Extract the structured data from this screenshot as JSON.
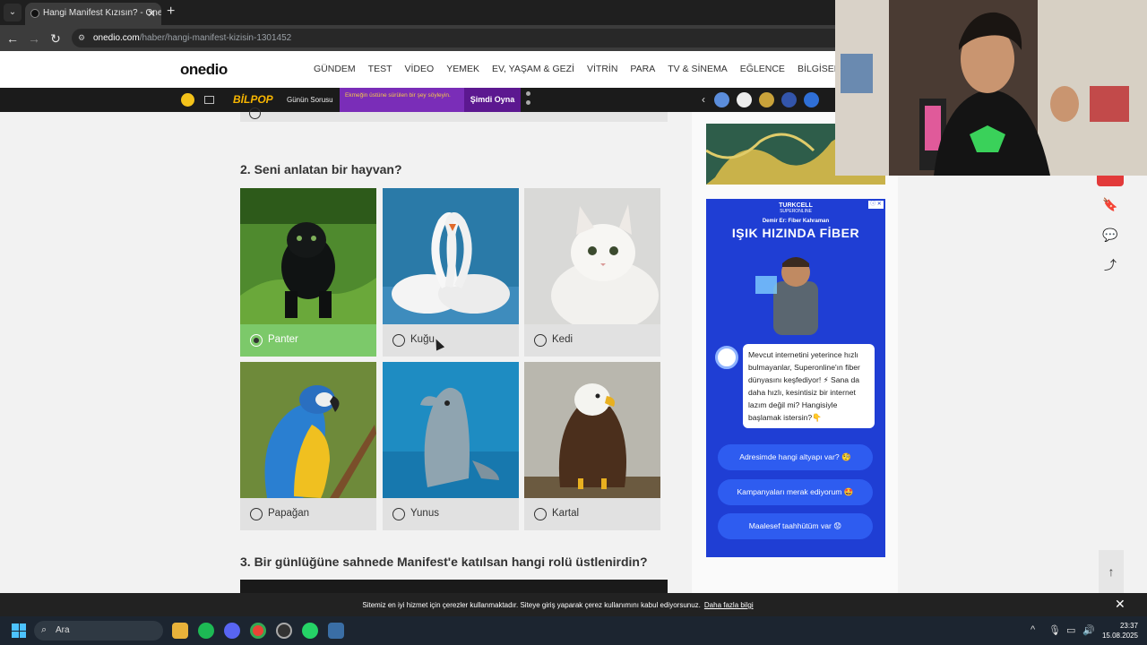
{
  "browser": {
    "tab_title": "Hangi Manifest Kızısın? - Onedio",
    "url_domain": "onedio.com",
    "url_path": "/haber/hangi-manifest-kizisin-1301452"
  },
  "site": {
    "logo": "onedio",
    "nav": [
      "GÜNDEM",
      "TEST",
      "VİDEO",
      "YEMEK",
      "EV, YAŞAM & GEZİ",
      "VİTRİN",
      "PARA",
      "TV & SİNEMA",
      "EĞLENCE",
      "BİLGİSEL"
    ]
  },
  "bilpop": {
    "logo": "BİLPOP",
    "label": "Günün Sorusu",
    "question": "Ekmeğin üstüne sürülen bir şey söyleyin.",
    "play": "Şimdi Oyna"
  },
  "quiz": {
    "q2_title": "2. Seni anlatan bir hayvan?",
    "q3_title": "3. Bir günlüğüne sahnede Manifest'e katılsan hangi rolü üstlenirdin?",
    "options": [
      "Panter",
      "Kuğu",
      "Kedi",
      "Papağan",
      "Yunus",
      "Kartal"
    ],
    "selected": "Panter"
  },
  "ad": {
    "brand": "TURKCELL",
    "brand_sub": "SUPERONLINE",
    "subtitle": "Demir Er: Fiber Kahraman",
    "headline": "IŞIK HIZINDA FİBER",
    "message": "Mevcut internetini yeterince hızlı bulmayanlar, Superonline'ın fiber dünyasını keşfediyor! ⚡ Sana da daha hızlı, kesintisiz bir internet lazım değil mi? Hangisiyle başlamak istersin?👇",
    "buttons": [
      "Adresimde hangi altyapı var? 🧐",
      "Kampanyaları merak ediyorum 🤩",
      "Maalesef taahhütüm var 😟"
    ]
  },
  "cookie": {
    "message": "Sitemiz en iyi hizmet için çerezler kullanmaktadır. Siteye giriş yaparak çerez kullanımını kabul ediyorsunuz.",
    "link": "Daha fazla bilgi"
  },
  "taskbar": {
    "search_placeholder": "Ara",
    "time": "23:37",
    "date": "15.08.2025"
  }
}
